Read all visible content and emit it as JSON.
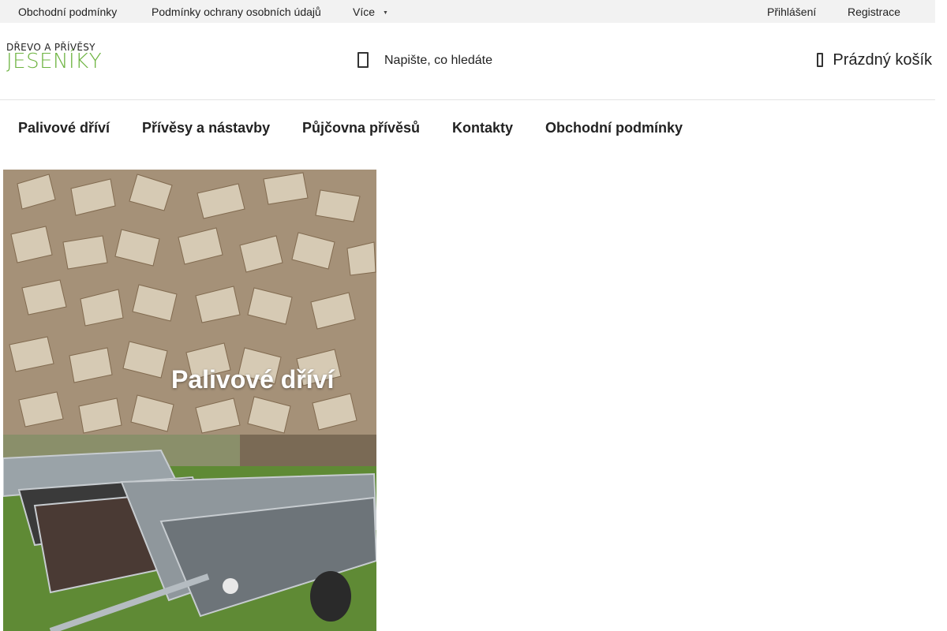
{
  "topbar": {
    "links": [
      "Obchodní podmínky",
      "Podmínky ochrany osobních údajů",
      "Více"
    ],
    "login": "Přihlášení",
    "register": "Registrace"
  },
  "header": {
    "logo": {
      "line1": "DŘEVO A PŘÍVĚSY",
      "line2": "JESENÍKY"
    },
    "search_placeholder": "Napište, co hledáte",
    "cart_label": "Prázdný košík"
  },
  "nav": {
    "items": [
      "Palivové dříví",
      "Přívěsy a nástavby",
      "Půjčovna přívěsů",
      "Kontakty",
      "Obchodní podmínky"
    ]
  },
  "tiles": [
    {
      "caption": "Palivové dříví"
    },
    {
      "caption": ""
    }
  ],
  "colors": {
    "logo_green": "#6cb33f",
    "topbar_bg": "#f2f2f2"
  },
  "icons": [
    "search-icon",
    "cart-icon",
    "chevron-down-icon"
  ]
}
